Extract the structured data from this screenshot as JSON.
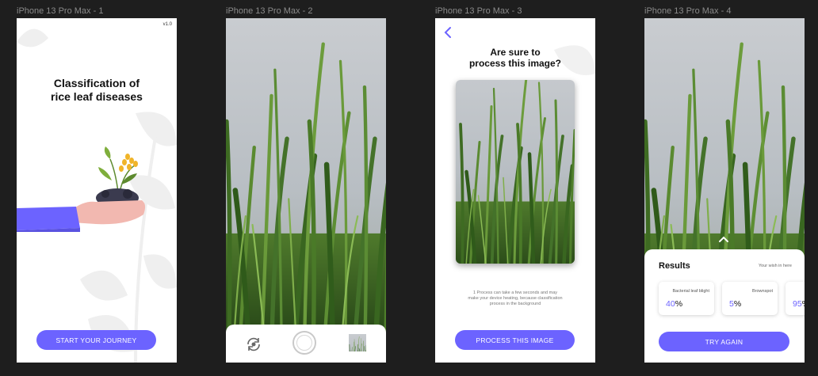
{
  "frames": [
    {
      "label": "iPhone 13 Pro Max - 1"
    },
    {
      "label": "iPhone 13 Pro Max - 2"
    },
    {
      "label": "iPhone 13 Pro Max - 3"
    },
    {
      "label": "iPhone 13 Pro Max - 4"
    }
  ],
  "screen1": {
    "version": "v1.0",
    "title_line1": "Classification of",
    "title_line2": "rice leaf diseases",
    "cta": "START YOUR JOURNEY"
  },
  "screen2": {
    "icons": [
      "flip-camera-icon",
      "shutter-button",
      "gallery-thumbnail"
    ]
  },
  "screen3": {
    "title_line1": "Are sure to",
    "title_line2": "process this image?",
    "note_line1": "1 Process can take a few seconds and may",
    "note_line2": "make your device heating, because classification",
    "note_line3": "process in the background",
    "cta": "PROCESS THIS IMAGE"
  },
  "screen4": {
    "results_title": "Results",
    "wish": "Your wish in here",
    "results": [
      {
        "name": "Bacterial leaf blight",
        "number": "40",
        "unit": "%"
      },
      {
        "name": "Brownspot",
        "number": "5",
        "unit": "%"
      },
      {
        "name": "",
        "number": "95",
        "unit": "%"
      }
    ],
    "cta": "TRY AGAIN"
  },
  "colors": {
    "accent": "#6c63ff",
    "canvas": "#1e1e1e",
    "sleeve": "#6c63ff",
    "hand": "#f2b8b0"
  }
}
